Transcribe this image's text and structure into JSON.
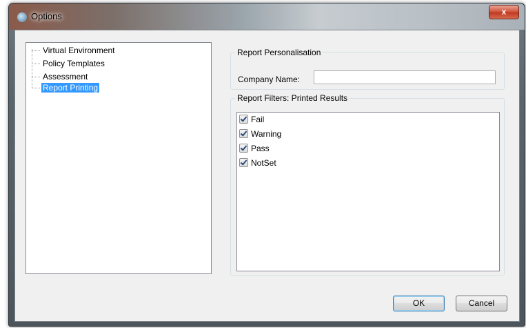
{
  "window": {
    "title": "Options",
    "close_glyph": "x"
  },
  "tree": {
    "items": [
      {
        "label": "Virtual Environment",
        "selected": false
      },
      {
        "label": "Policy Templates",
        "selected": false
      },
      {
        "label": "Assessment",
        "selected": false
      },
      {
        "label": "Report Printing",
        "selected": true
      }
    ]
  },
  "personalisation": {
    "legend": "Report Personalisation",
    "company_label": "Company Name:",
    "company_value": ""
  },
  "filters": {
    "legend": "Report Filters: Printed Results",
    "items": [
      {
        "label": "Fail",
        "checked": true
      },
      {
        "label": "Warning",
        "checked": true
      },
      {
        "label": "Pass",
        "checked": true
      },
      {
        "label": "NotSet",
        "checked": true
      }
    ]
  },
  "buttons": {
    "ok": "OK",
    "cancel": "Cancel"
  },
  "colors": {
    "selection": "#3399ff",
    "close_button": "#c03a22"
  }
}
